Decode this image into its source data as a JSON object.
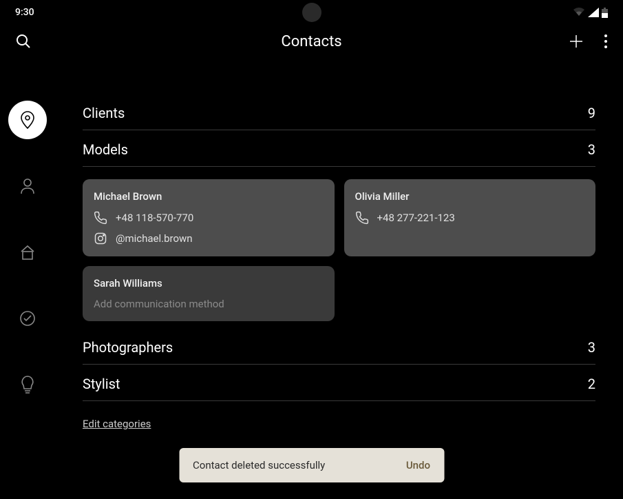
{
  "status": {
    "time": "9:30"
  },
  "appbar": {
    "title": "Contacts"
  },
  "categories": {
    "clients": {
      "label": "Clients",
      "count": "9"
    },
    "models": {
      "label": "Models",
      "count": "3"
    },
    "photographers": {
      "label": "Photographers",
      "count": "3"
    },
    "stylist": {
      "label": "Stylist",
      "count": "2"
    }
  },
  "models": {
    "c0": {
      "name": "Michael Brown",
      "phone": "+48 118-570-770",
      "instagram": "@michael.brown"
    },
    "c1": {
      "name": "Olivia Miller",
      "phone": "+48 277-221-123"
    },
    "c2": {
      "name": "Sarah Williams",
      "placeholder": "Add communication method"
    }
  },
  "editLink": "Edit categories",
  "toast": {
    "message": "Contact deleted successfully",
    "action": "Undo"
  }
}
